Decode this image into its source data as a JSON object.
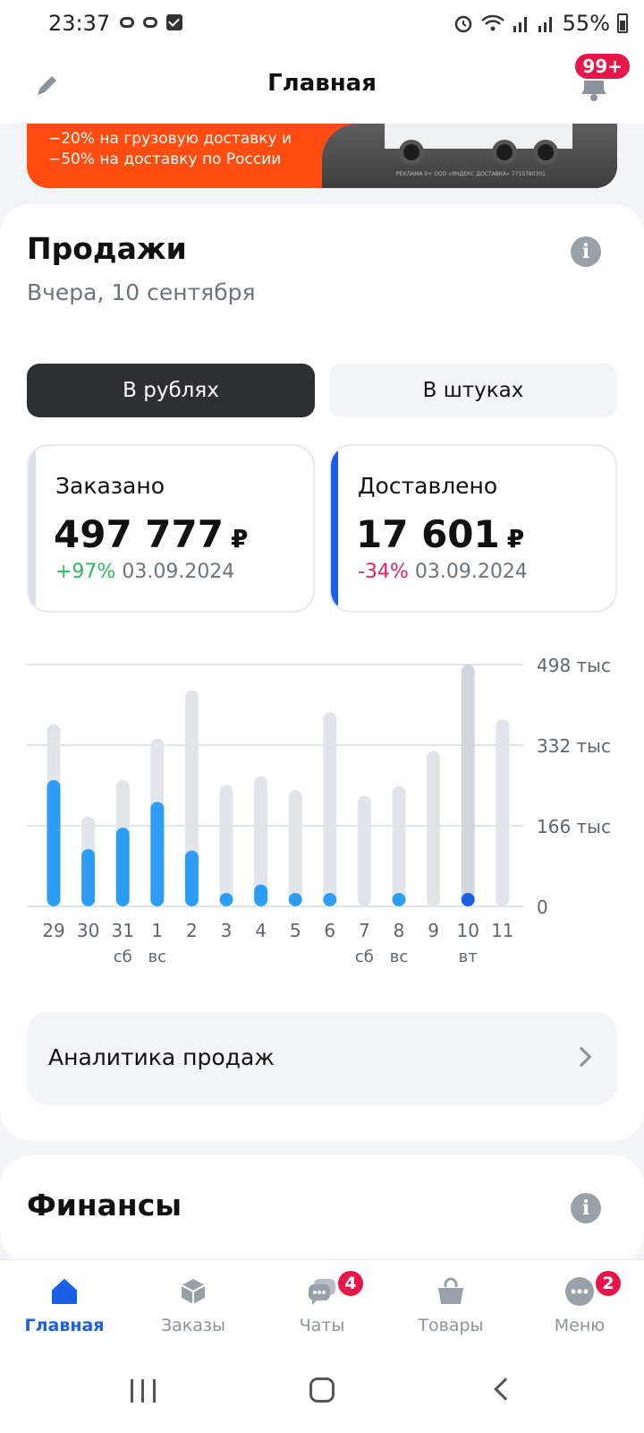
{
  "status_bar": {
    "time": "23:37",
    "battery": "55%"
  },
  "header": {
    "title": "Главная",
    "notifications_badge": "99+"
  },
  "banner": {
    "line1": "−20% на грузовую доставку и",
    "line2": "−50% на доставку по России",
    "ad_note": "РЕКЛАМА 0+ ООО «ЯНДЕКС ДОСТАВКА» 7715780301"
  },
  "sales": {
    "title": "Продажи",
    "subtitle": "Вчера, 10 сентября",
    "toggle": {
      "rubles": "В рублях",
      "pieces": "В штуках",
      "selected": "rubles"
    },
    "ordered": {
      "label": "Заказано",
      "value": "497 777",
      "currency": "₽",
      "change": "+97%",
      "compare_date": "03.09.2024"
    },
    "delivered": {
      "label": "Доставлено",
      "value": "17 601",
      "currency": "₽",
      "change": "-34%",
      "compare_date": "03.09.2024"
    },
    "analytics_link": "Аналитика продаж"
  },
  "chart_data": {
    "type": "bar",
    "categories": [
      "29",
      "30",
      "31",
      "1",
      "2",
      "3",
      "4",
      "5",
      "6",
      "7",
      "8",
      "9",
      "10",
      "11"
    ],
    "category_sublabels": [
      "",
      "",
      "сб",
      "вс",
      "",
      "",
      "",
      "",
      "",
      "сб",
      "вс",
      "",
      "вт",
      ""
    ],
    "series": [
      {
        "values": [
          375,
          185,
          260,
          345,
          445,
          250,
          268,
          240,
          400,
          228,
          248,
          320,
          498,
          385
        ]
      },
      {
        "values": [
          260,
          118,
          162,
          215,
          115,
          18,
          45,
          18,
          18,
          0,
          18,
          0,
          18,
          0
        ]
      }
    ],
    "y_ticks": [
      "0",
      "166 тыс",
      "332 тыс",
      "498 тыс"
    ],
    "y_tick_values": [
      0,
      166,
      332,
      498
    ],
    "ylim": [
      0,
      498
    ],
    "selected_category": "10",
    "colors": {
      "background_bar": "#e1e5ea",
      "background_bar_selected": "#d2d7dd",
      "value_bar": "#2e9ef4",
      "value_bar_selected": "#1a5fe6",
      "grid": "#dde4ec"
    }
  },
  "finance": {
    "title": "Финансы"
  },
  "bottom_nav": {
    "items": [
      {
        "label": "Главная",
        "icon": "home-icon",
        "active": true,
        "badge": ""
      },
      {
        "label": "Заказы",
        "icon": "box-icon",
        "active": false,
        "badge": ""
      },
      {
        "label": "Чаты",
        "icon": "chat-icon",
        "active": false,
        "badge": "4"
      },
      {
        "label": "Товары",
        "icon": "bag-icon",
        "active": false,
        "badge": ""
      },
      {
        "label": "Меню",
        "icon": "menu-dots-icon",
        "active": false,
        "badge": "2"
      }
    ]
  }
}
